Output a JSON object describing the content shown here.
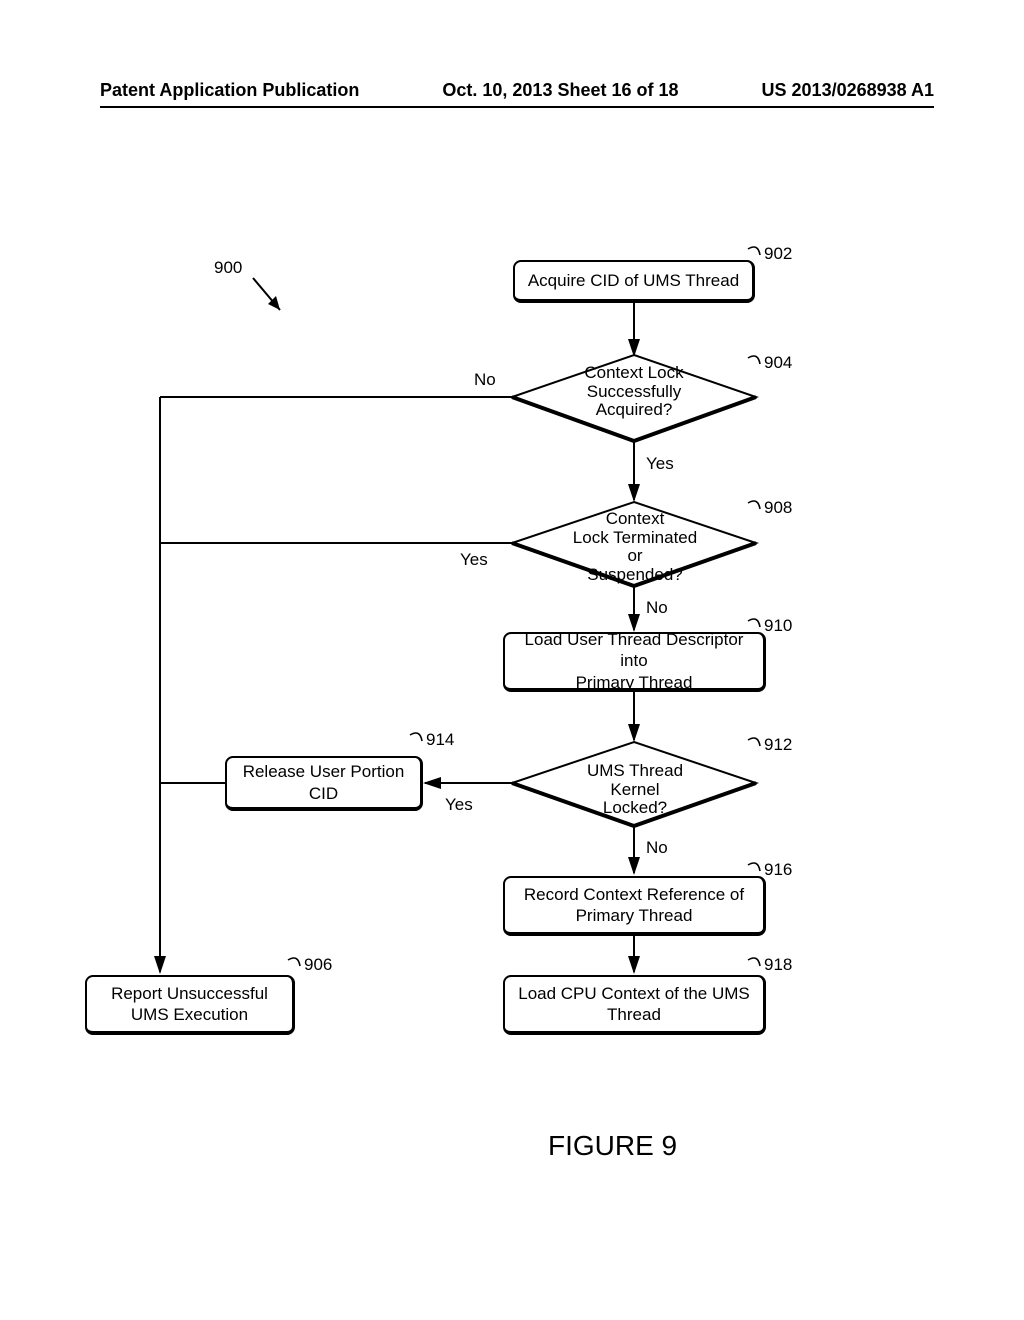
{
  "header": {
    "left": "Patent Application Publication",
    "center": "Oct. 10, 2013   Sheet 16 of 18",
    "right": "US 2013/0268938 A1"
  },
  "refs": {
    "n900": "900",
    "n902": "902",
    "n904": "904",
    "n906": "906",
    "n908": "908",
    "n910": "910",
    "n912": "912",
    "n914": "914",
    "n916": "916",
    "n918": "918"
  },
  "blocks": {
    "b902": "Acquire CID of UMS Thread",
    "b904_l1": "Context Lock",
    "b904_l2": "Successfully",
    "b904_l3": "Acquired?",
    "b908_l1": "Context",
    "b908_l2": "Lock Terminated or",
    "b908_l3": "Suspended?",
    "b910_l1": "Load User Thread Descriptor into",
    "b910_l2": "Primary Thread",
    "b912_l1": "UMS Thread Kernel",
    "b912_l2": "Locked?",
    "b914_l1": "Release User Portion",
    "b914_l2": "CID",
    "b916_l1": "Record Context Reference of",
    "b916_l2": "Primary Thread",
    "b918_l1": "Load CPU Context of the UMS",
    "b918_l2": "Thread",
    "b906_l1": "Report Unsuccessful",
    "b906_l2": "UMS Execution"
  },
  "edges": {
    "no": "No",
    "yes": "Yes"
  },
  "figure": "FIGURE 9"
}
